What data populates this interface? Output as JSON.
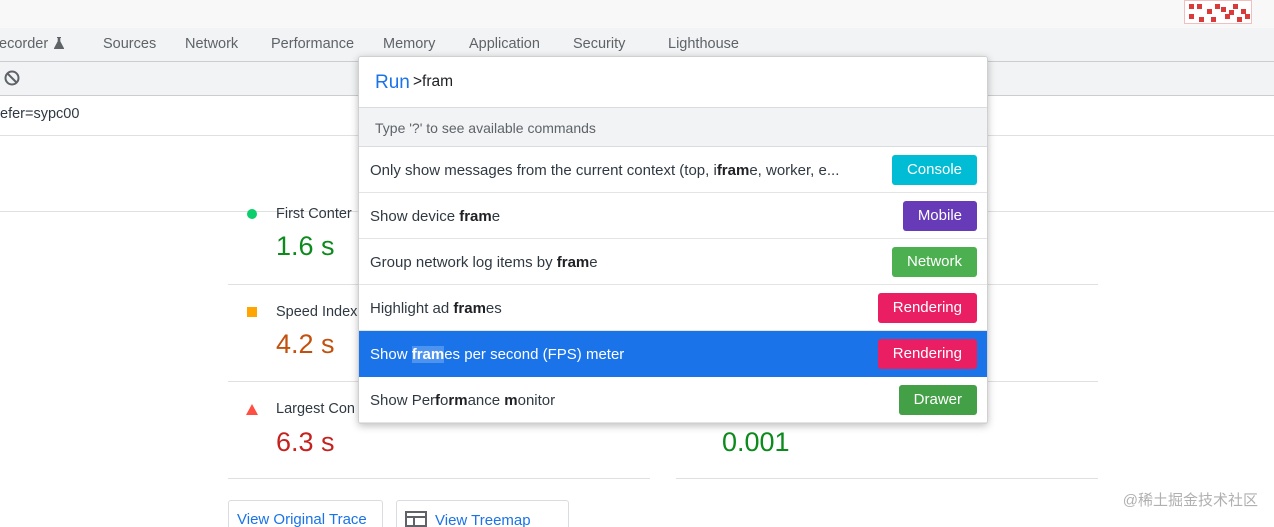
{
  "colors": {
    "accent": "#1a73e8",
    "badge_console": "#00bcd4",
    "badge_mobile": "#673ab7",
    "badge_network": "#4caf50",
    "badge_rendering": "#e91e63",
    "badge_drawer": "#43a047",
    "good": "#0c8a1c",
    "average": "#c3500d",
    "poor": "#c5221f"
  },
  "tabs": {
    "recorder": "ecorder",
    "sources": "Sources",
    "network": "Network",
    "performance": "Performance",
    "memory": "Memory",
    "application": "Application",
    "security": "Security",
    "lighthouse": "Lighthouse"
  },
  "url_fragment": "efer=sypc00",
  "metrics": {
    "fcp": {
      "label": "First Conter",
      "value": "1.6 s"
    },
    "si": {
      "label": "Speed Index",
      "value": "4.2 s"
    },
    "lcp": {
      "label": "Largest Con",
      "value": "6.3 s"
    },
    "cls": {
      "value": "0.001"
    }
  },
  "buttons": {
    "view_trace": "View Original Trace",
    "view_treemap": "View Treemap"
  },
  "watermark": "@稀土掘金技术社区",
  "command_menu": {
    "prompt": "Run",
    "query": ">fram",
    "hint": "Type '?' to see available commands",
    "items": [
      {
        "parts": [
          "Only show messages from the current context (top, i",
          "fram",
          "e, worker, e..."
        ],
        "badge": "Console",
        "badge_color": "#00bcd4"
      },
      {
        "parts": [
          "Show device ",
          "fram",
          "e"
        ],
        "badge": "Mobile",
        "badge_color": "#673ab7"
      },
      {
        "parts": [
          "Group network log items by ",
          "fram",
          "e"
        ],
        "badge": "Network",
        "badge_color": "#4caf50"
      },
      {
        "parts": [
          "Highlight ad ",
          "fram",
          "es"
        ],
        "badge": "Rendering",
        "badge_color": "#e91e63"
      },
      {
        "parts": [
          "Show ",
          "fram",
          "es per second (FPS) meter"
        ],
        "badge": "Rendering",
        "badge_color": "#e91e63"
      },
      {
        "parts": [
          "Show Per",
          "f",
          "o",
          "r",
          "",
          "m",
          "ance ",
          "m",
          "onitor"
        ],
        "badge": "Drawer",
        "badge_color": "#43a047"
      }
    ]
  }
}
